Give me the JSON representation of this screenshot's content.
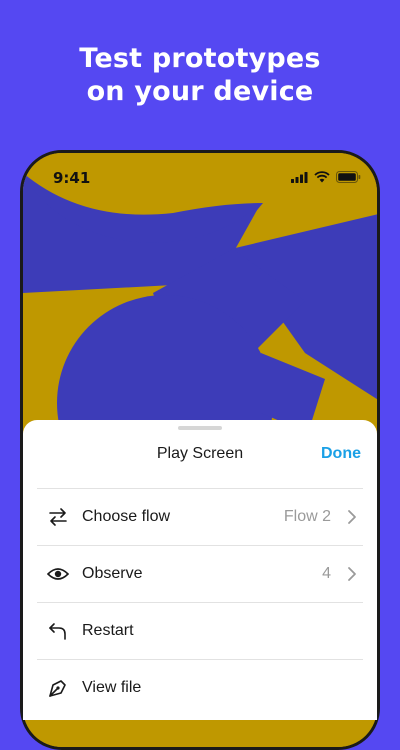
{
  "headline": {
    "line1": "Test prototypes",
    "line2": "on your device"
  },
  "status_bar": {
    "time": "9:41",
    "icons": [
      "signal-icon",
      "wifi-icon",
      "battery-icon"
    ]
  },
  "sheet": {
    "title": "Play Screen",
    "done_label": "Done",
    "items": [
      {
        "label": "Choose flow",
        "value": "Flow 2",
        "icon": "arrows-flow-icon",
        "has_chevron": true
      },
      {
        "label": "Observe",
        "value": "4",
        "icon": "eye-icon",
        "has_chevron": true
      },
      {
        "label": "Restart",
        "value": "",
        "icon": "undo-arrow-icon",
        "has_chevron": false
      },
      {
        "label": "View file",
        "value": "",
        "icon": "pen-nib-icon",
        "has_chevron": false
      }
    ]
  },
  "colors": {
    "background": "#5548f2",
    "artwork_gold": "#bf9800",
    "artwork_blue": "#3d3cb8",
    "accent": "#1aa0e6"
  }
}
